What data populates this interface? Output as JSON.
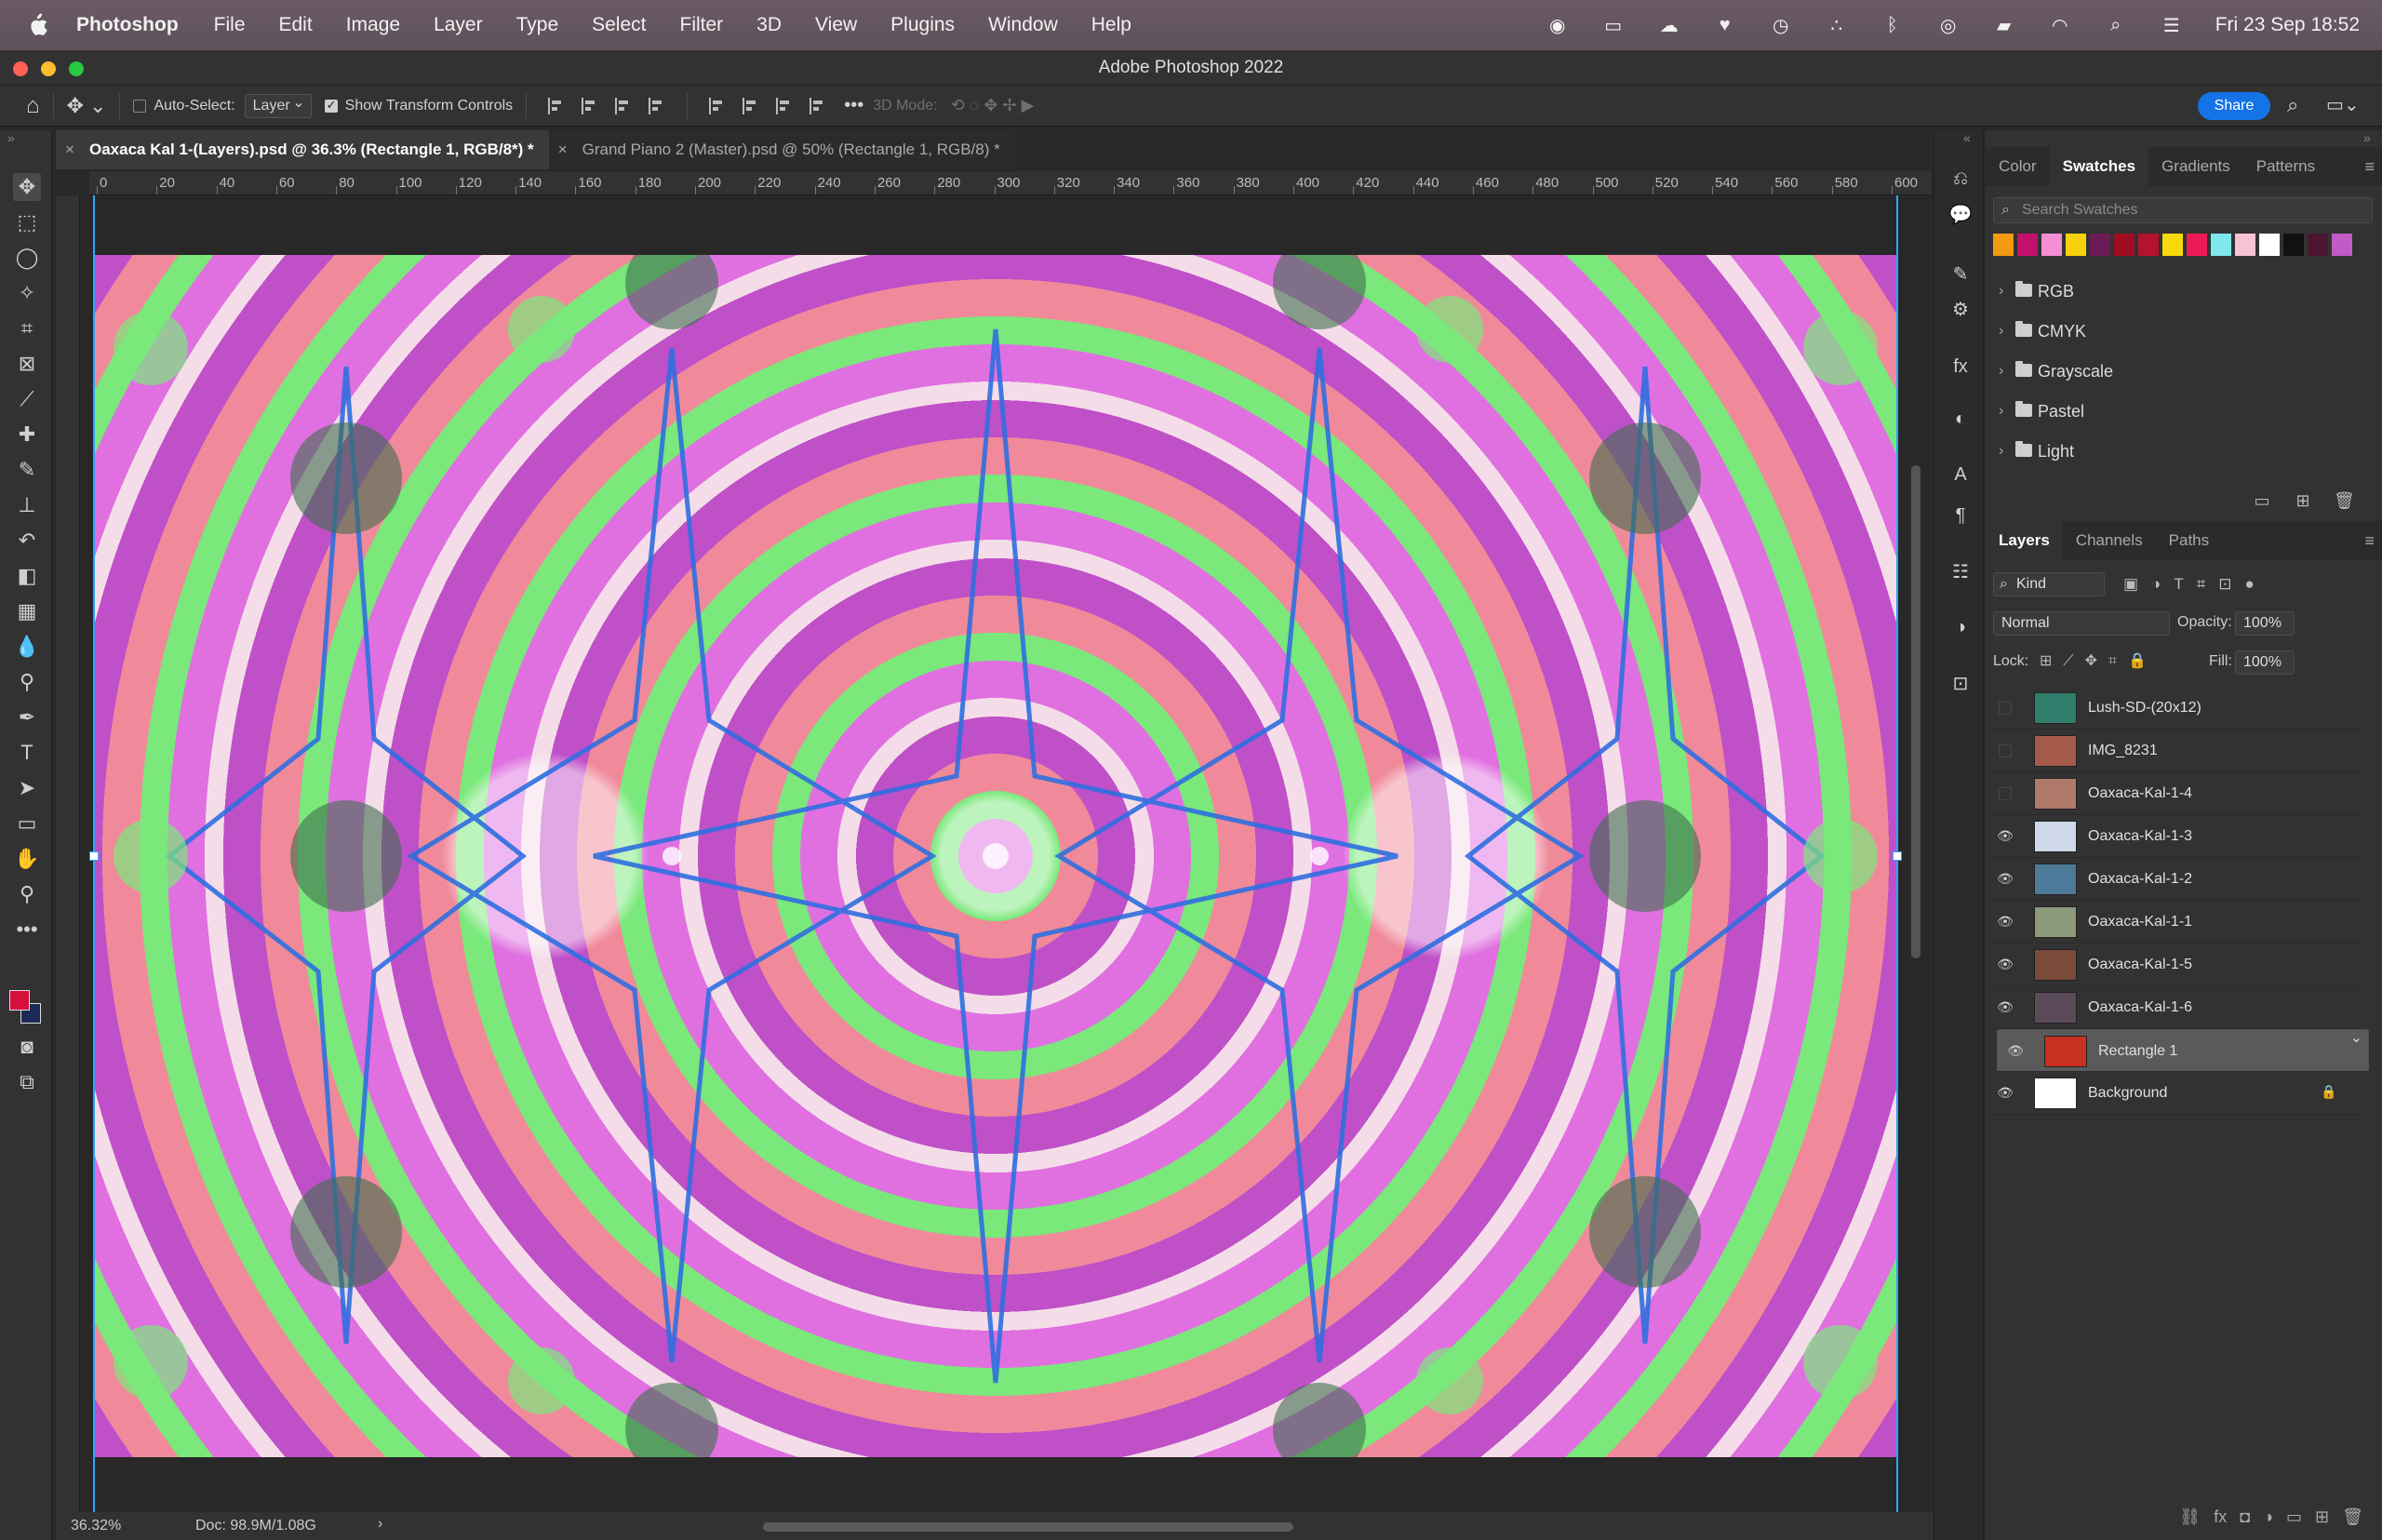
{
  "menubar": {
    "app_name": "Photoshop",
    "items": [
      "File",
      "Edit",
      "Image",
      "Layer",
      "Type",
      "Select",
      "Filter",
      "3D",
      "View",
      "Plugins",
      "Window",
      "Help"
    ],
    "datetime": "Fri 23 Sep  18:52"
  },
  "window": {
    "title": "Adobe Photoshop 2022"
  },
  "options": {
    "auto_select_label": "Auto-Select:",
    "auto_select_value": "Layer",
    "show_transform_label": "Show Transform Controls",
    "mode_label": "3D Mode:",
    "share_label": "Share"
  },
  "tabs": [
    {
      "label": "Oaxaca Kal 1-(Layers).psd @ 36.3% (Rectangle 1, RGB/8*) *",
      "active": true
    },
    {
      "label": "Grand Piano 2 (Master).psd @ 50% (Rectangle 1, RGB/8) *",
      "active": false
    }
  ],
  "ruler": {
    "labels": [
      "0",
      "20",
      "40",
      "60",
      "80",
      "100",
      "120",
      "140",
      "160",
      "180",
      "200",
      "220",
      "240",
      "260",
      "280",
      "300",
      "320",
      "340",
      "360",
      "380",
      "400",
      "420",
      "440",
      "460",
      "480",
      "500",
      "520",
      "540",
      "560",
      "580",
      "600"
    ]
  },
  "status": {
    "zoom": "36.32%",
    "doc": "Doc: 98.9M/1.08G",
    "arrow": "›"
  },
  "swatches_panel": {
    "tabs": [
      "Color",
      "Swatches",
      "Gradients",
      "Patterns"
    ],
    "active_tab": "Swatches",
    "search_placeholder": "Search Swatches",
    "swatch_colors": [
      "#f39a12",
      "#c2116a",
      "#f58fd5",
      "#f8d10c",
      "#6b1b56",
      "#a00d20",
      "#b4122e",
      "#f7d90c",
      "#ec1a57",
      "#7ee8ec",
      "#f7c3d3",
      "#ffffff",
      "#111111",
      "#4b1532",
      "#c25bc6"
    ],
    "folders": [
      "RGB",
      "CMYK",
      "Grayscale",
      "Pastel",
      "Light"
    ]
  },
  "layers_panel": {
    "tabs": [
      "Layers",
      "Channels",
      "Paths"
    ],
    "active_tab": "Layers",
    "filter_kind": "Kind",
    "blend_mode": "Normal",
    "opacity_label": "Opacity:",
    "opacity_value": "100%",
    "lock_label": "Lock:",
    "fill_label": "Fill:",
    "fill_value": "100%",
    "layers": [
      {
        "name": "Lush-SD-(20x12)",
        "visible": false,
        "thumb": "#2f7d6a"
      },
      {
        "name": "IMG_8231",
        "visible": false,
        "thumb": "#a55a4a"
      },
      {
        "name": "Oaxaca-Kal-1-4",
        "visible": false,
        "thumb": "#b07a6a"
      },
      {
        "name": "Oaxaca-Kal-1-3",
        "visible": true,
        "thumb": "#cfd8e8"
      },
      {
        "name": "Oaxaca-Kal-1-2",
        "visible": true,
        "thumb": "#4e7a9a"
      },
      {
        "name": "Oaxaca-Kal-1-1",
        "visible": true,
        "thumb": "#8a9a7a"
      },
      {
        "name": "Oaxaca-Kal-1-5",
        "visible": true,
        "thumb": "#7a4a3a"
      },
      {
        "name": "Oaxaca-Kal-1-6",
        "visible": true,
        "thumb": "#5a4a5a"
      },
      {
        "name": "Rectangle 1",
        "visible": true,
        "thumb": "#c83020",
        "selected": true
      },
      {
        "name": "Background",
        "visible": true,
        "thumb": "#ffffff",
        "locked": true
      }
    ]
  },
  "colors": {
    "accent": "#1473e6",
    "guide": "#2aa7ff",
    "foreground": "#d4103c",
    "background_swatch": "#1a2a55"
  }
}
